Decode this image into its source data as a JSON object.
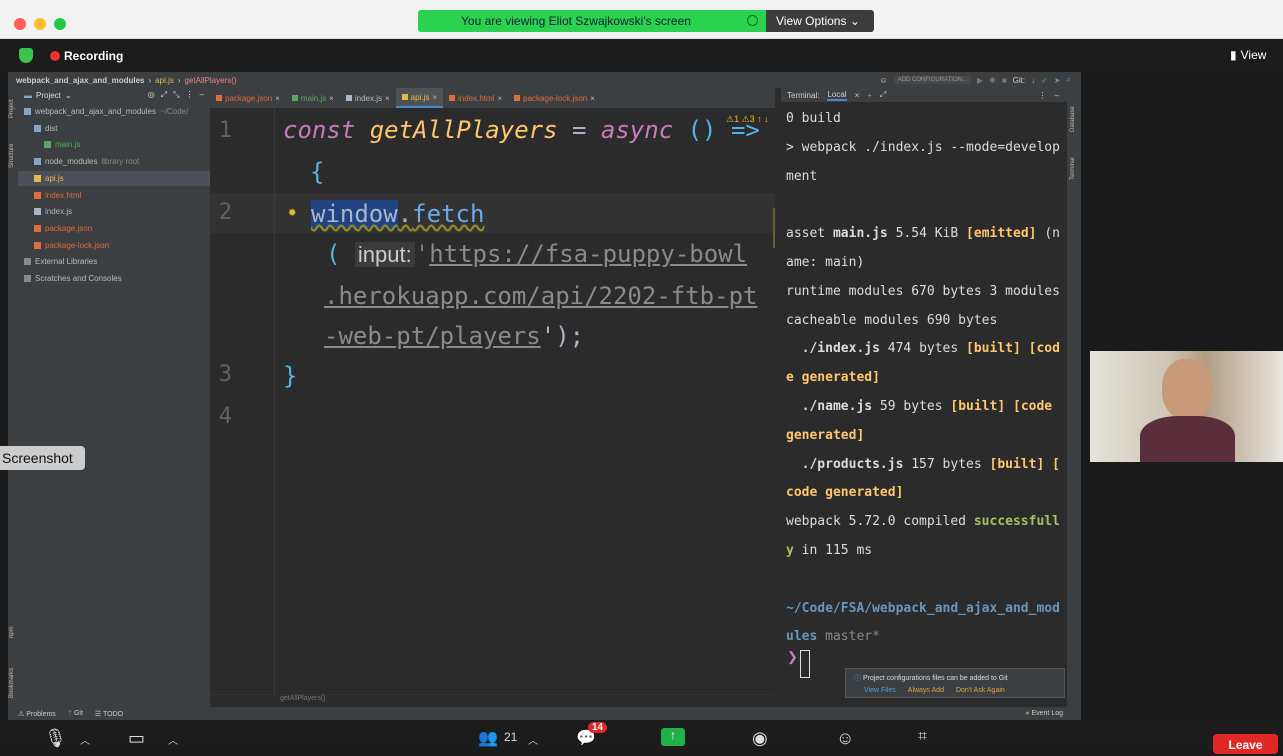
{
  "share_banner": {
    "text": "You are viewing Eliot Szwajkowski's screen",
    "options_label": "View Options"
  },
  "zoom_top": {
    "recording_label": "Recording",
    "view_label": "View"
  },
  "breadcrumb": {
    "project": "webpack_and_ajax_and_modules",
    "file": "api.js",
    "func": "getAllPlayers()",
    "run_config": "ADD CONFIGURATION...",
    "git_label": "Git:"
  },
  "project_panel": {
    "title": "Project",
    "items": [
      {
        "label": "webpack_and_ajax_and_modules",
        "suffix": "~/Code/",
        "indent": 0
      },
      {
        "label": "dist",
        "suffix": "",
        "indent": 1
      },
      {
        "label": "main.js",
        "suffix": "",
        "indent": 2
      },
      {
        "label": "node_modules",
        "suffix": "library root",
        "indent": 1
      },
      {
        "label": "api.js",
        "suffix": "",
        "indent": 1
      },
      {
        "label": "index.html",
        "suffix": "",
        "indent": 1
      },
      {
        "label": "index.js",
        "suffix": "",
        "indent": 1
      },
      {
        "label": "package.json",
        "suffix": "",
        "indent": 1
      },
      {
        "label": "package-lock.json",
        "suffix": "",
        "indent": 1
      },
      {
        "label": "External Libraries",
        "suffix": "",
        "indent": 0
      },
      {
        "label": "Scratches and Consoles",
        "suffix": "",
        "indent": 0
      }
    ]
  },
  "side_tabs": {
    "project": "Project",
    "structure": "Structure",
    "npm": "npm",
    "bookmarks": "Bookmarks",
    "database": "Database",
    "terminal": "Terminal"
  },
  "editor_tabs": [
    "package.json",
    "main.js",
    "index.js",
    "api.js",
    "index.html",
    "package-lock.json"
  ],
  "code": {
    "line_numbers": [
      "1",
      "2",
      "3",
      "4"
    ],
    "l1": {
      "kw": "const",
      "name": "getAllPlayers",
      "eq": "=",
      "async": "async",
      "parens": "()",
      "arrow": "=>"
    },
    "l1b": "{",
    "l2": {
      "obj": "window",
      "dot": ".",
      "method": "fetch"
    },
    "l2b": {
      "open": "(",
      "hint": "input:",
      "q": "'",
      "url1": "https://fsa-puppy-bowl"
    },
    "l2c": ".herokuapp.com/api/2202-ftb-pt",
    "l2d": {
      "url3": "-web-pt/players",
      "end": "');"
    },
    "l3": "}"
  },
  "status_func": "getAllPlayers()",
  "terminal": {
    "title": "Terminal:",
    "tab": "Local",
    "lines": [
      {
        "t": "0 build"
      },
      {
        "t": "> webpack ./index.js --mode=develop"
      },
      {
        "t": "ment"
      },
      {
        "t": ""
      },
      {
        "a": "asset ",
        "b": "main.js",
        "c": " 5.54 KiB ",
        "d": "[emitted]",
        "e": " (n"
      },
      {
        "t": "ame: main)"
      },
      {
        "t": "runtime modules 670 bytes 3 modules"
      },
      {
        "t": "cacheable modules 690 bytes"
      },
      {
        "a": "  ",
        "b": "./index.js",
        "c": " 474 bytes ",
        "d": "[built] [cod",
        "e": ""
      },
      {
        "o": "e generated]"
      },
      {
        "a": "  ",
        "b": "./name.js",
        "c": " 59 bytes ",
        "d": "[built] [code",
        "e": ""
      },
      {
        "o": "generated]"
      },
      {
        "a": "  ",
        "b": "./products.js",
        "c": " 157 bytes ",
        "d": "[built] [",
        "e": ""
      },
      {
        "o": "code generated]"
      },
      {
        "a": "webpack 5.72.0 compiled ",
        "gr": "successfull"
      },
      {
        "gr2": "y",
        "c2": " in 115 ms"
      },
      {
        "t": ""
      },
      {
        "blue": "~/Code/FSA/webpack_and_ajax_and_mod"
      },
      {
        "blue2": "ules",
        "grey": " master*"
      }
    ],
    "prompt": "❯"
  },
  "notification": {
    "text": "Project configurations files can be added to Git",
    "a1": "View Files",
    "a2": "Always Add",
    "a3": "Don't Ask Again"
  },
  "bottom_bar": {
    "problems": "Problems",
    "git": "Git",
    "todo": "TODO",
    "event_log": "Event Log"
  },
  "screenshot_label": "Screenshot",
  "zoom_bottom": {
    "participants": "21",
    "chat_badge": "14",
    "leave": "Leave"
  },
  "colors": {
    "keyword": "#cc7832",
    "italic_kw": "#c77dbb",
    "func": "#ffc66d",
    "string": "#6a8759",
    "terminal_yellow": "#ffc66d",
    "terminal_green": "#a5c25c",
    "terminal_blue": "#6897bb"
  }
}
